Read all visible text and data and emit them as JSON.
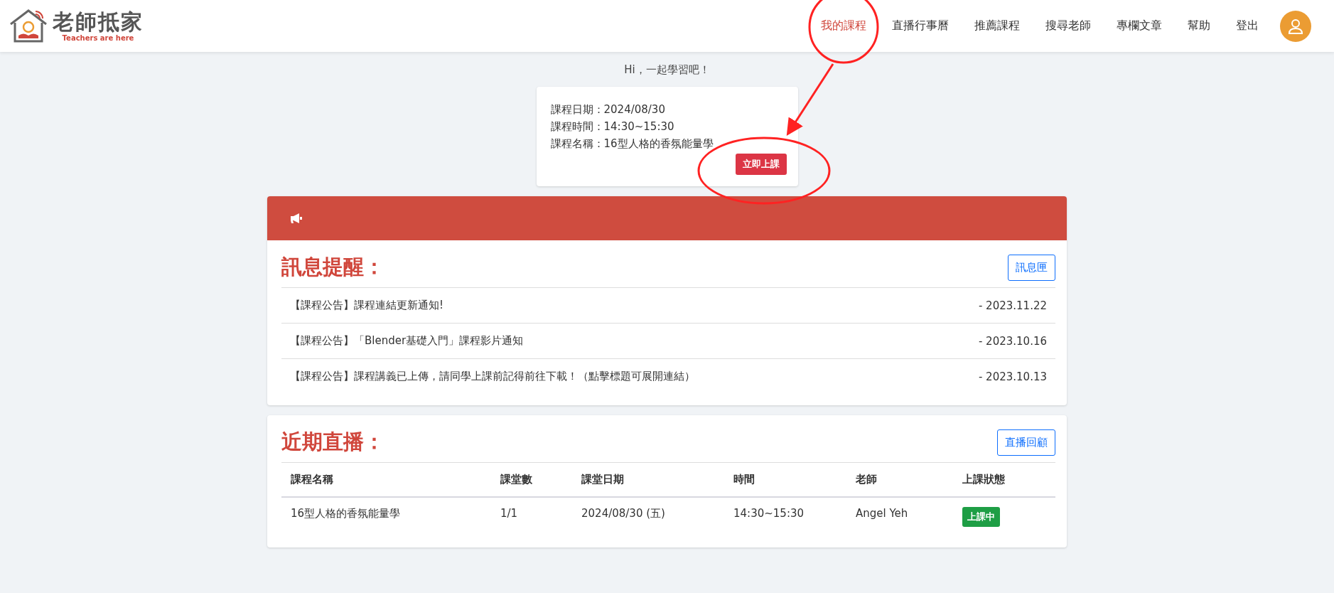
{
  "logo": {
    "title": "老師抵家",
    "tagline": "Teachers are here"
  },
  "nav": [
    {
      "label": "我的課程",
      "selected": true
    },
    {
      "label": "直播行事曆",
      "selected": false
    },
    {
      "label": "推薦課程",
      "selected": false
    },
    {
      "label": "搜尋老師",
      "selected": false
    },
    {
      "label": "專欄文章",
      "selected": false
    },
    {
      "label": "幫助",
      "selected": false
    },
    {
      "label": "登出",
      "selected": false
    }
  ],
  "greeting": "Hi，一起學習吧！",
  "next_class": {
    "lines": [
      "課程日期：2024/08/30",
      "課程時間：14:30~15:30",
      "課程名稱：16型人格的香氛能量學"
    ],
    "button": "立即上課"
  },
  "notices": {
    "title": "訊息提醒：",
    "button": "訊息匣",
    "items": [
      {
        "text": "【課程公告】課程連結更新通知!",
        "date": "- 2023.11.22"
      },
      {
        "text": "【課程公告】「Blender基礎入門」課程影片通知",
        "date": "- 2023.10.16"
      },
      {
        "text": "【課程公告】課程講義已上傳，請同學上課前記得前往下載！（點擊標題可展開連結）",
        "date": "- 2023.10.13"
      }
    ]
  },
  "live": {
    "title": "近期直播：",
    "button": "直播回顧",
    "columns": [
      "課程名稱",
      "課堂數",
      "課堂日期",
      "時間",
      "老師",
      "上課狀態"
    ],
    "rows": [
      {
        "cells": [
          "16型人格的香氛能量學",
          "1/1",
          "2024/08/30 (五)",
          "14:30~15:30",
          "Angel Yeh"
        ],
        "status": "上課中"
      }
    ]
  }
}
